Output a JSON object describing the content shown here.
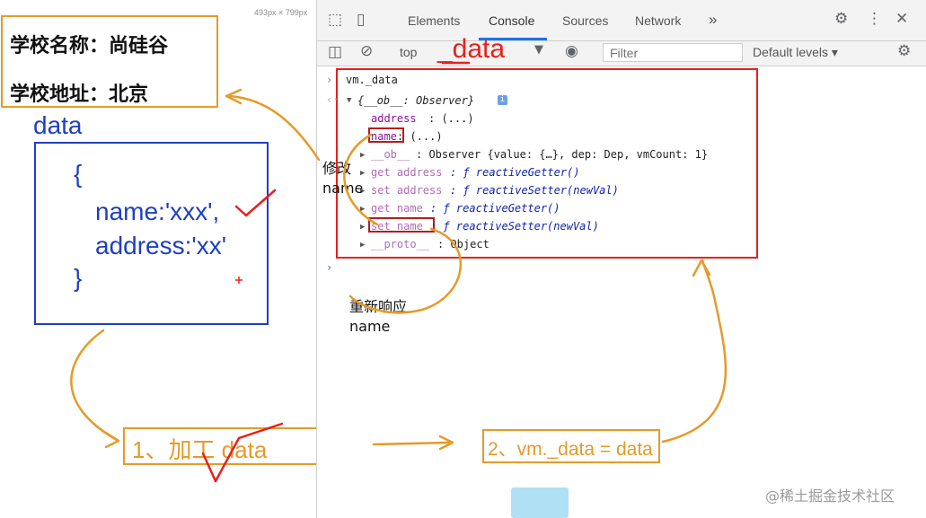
{
  "page_preview": {
    "size_readout": "493px × 799px",
    "school_name_line": "学校名称：尚硅谷",
    "school_address_line": "学校地址：北京",
    "data_label": "data",
    "code_open": "{",
    "code_name": "name:'xxx',",
    "code_address": "address:'xx'",
    "code_close": "}"
  },
  "devtools": {
    "tabs": [
      "Elements",
      "Console",
      "Sources",
      "Network"
    ],
    "active_tab": "Console",
    "more_tabs": "»",
    "toolbar": {
      "context": "top",
      "filter_placeholder": "Filter",
      "levels": "Default levels ▾"
    },
    "console": {
      "input_prompt": "›",
      "input": "vm._data",
      "result_prompt": "‹·",
      "result_header": "{__ob__: Observer}",
      "info_badge": "i",
      "lines": {
        "address": "address",
        "address_val": ": (...)",
        "name": "name",
        "name_val": ": (...)",
        "ob": "__ob__",
        "ob_val": ": Observer {value: {…}, dep: Dep, vmCount: 1}",
        "get_address": "get address",
        "get_address_val": ": ƒ reactiveGetter()",
        "set_address": "set address",
        "set_address_val": ": ƒ reactiveSetter(newVal)",
        "get_name": "get name",
        "get_name_val": ": ƒ reactiveGetter()",
        "set_name": "set name",
        "set_name_val": ": ƒ reactiveSetter(newVal)",
        "proto": "__proto__",
        "proto_val": ": Object"
      },
      "next_prompt": "›"
    }
  },
  "annotations": {
    "data_title": "_data",
    "modify_line1": "修改",
    "modify_line2": "name",
    "respond_line1": "重新响应",
    "respond_line2": "name",
    "step1": "1、加工 data",
    "step2": "2、vm._data = data"
  },
  "watermark": "@稀土掘金技术社区",
  "colors": {
    "annotation_orange": "#e69a28",
    "annotation_red": "#e8201b",
    "code_blue": "#1f3fbf",
    "devtools_tab_active": "#1a73e8"
  }
}
